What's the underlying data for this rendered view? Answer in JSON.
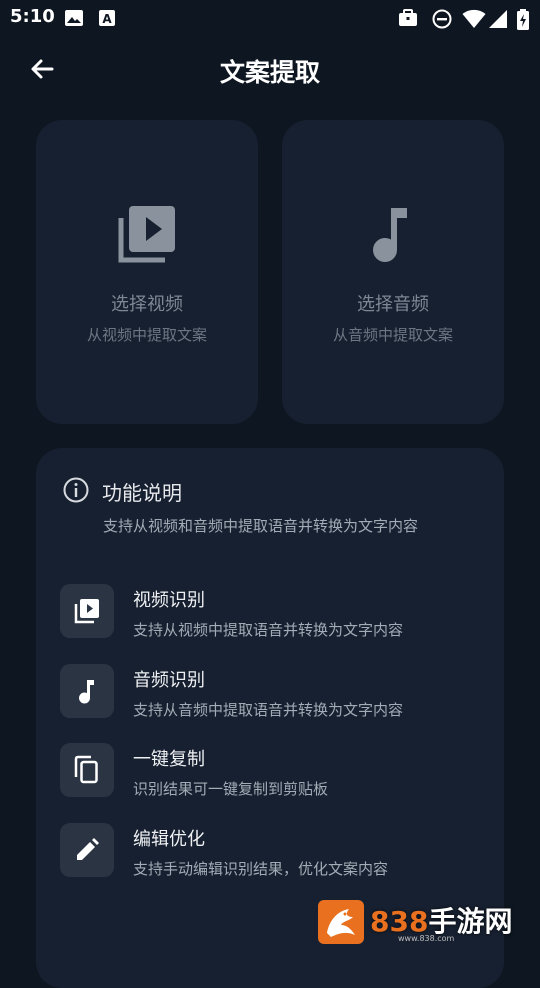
{
  "status_bar": {
    "time": "5:10",
    "left_icons": [
      "image-icon",
      "text-a-icon"
    ],
    "right_icons": [
      "briefcase-icon",
      "do-not-disturb-icon",
      "wifi-icon",
      "signal-icon",
      "battery-charging-icon"
    ]
  },
  "header": {
    "title": "文案提取",
    "back_icon": "arrow-left-icon"
  },
  "cards": [
    {
      "title": "选择视频",
      "subtitle": "从视频中提取文案",
      "icon": "video-library-icon"
    },
    {
      "title": "选择音频",
      "subtitle": "从音频中提取文案",
      "icon": "music-note-icon"
    }
  ],
  "info_panel": {
    "title": "功能说明",
    "icon": "info-icon",
    "description": "支持从视频和音频中提取语音并转换为文字内容",
    "features": [
      {
        "title": "视频识别",
        "subtitle": "支持从视频中提取语音并转换为文字内容",
        "icon": "video-file-icon"
      },
      {
        "title": "音频识别",
        "subtitle": "支持从音频中提取语音并转换为文字内容",
        "icon": "music-note-icon"
      },
      {
        "title": "一键复制",
        "subtitle": "识别结果可一键复制到剪贴板",
        "icon": "copy-icon"
      },
      {
        "title": "编辑优化",
        "subtitle": "支持手动编辑识别结果，优化文案内容",
        "icon": "edit-pencil-icon"
      }
    ]
  },
  "watermark": {
    "number": "838",
    "text": "手游网",
    "url": "www.838.com"
  },
  "colors": {
    "background": "#0e1621",
    "card": "#172030",
    "icon_tile": "#2a3442",
    "muted_text": "#7e8794",
    "watermark_orange": "#e8701f"
  }
}
